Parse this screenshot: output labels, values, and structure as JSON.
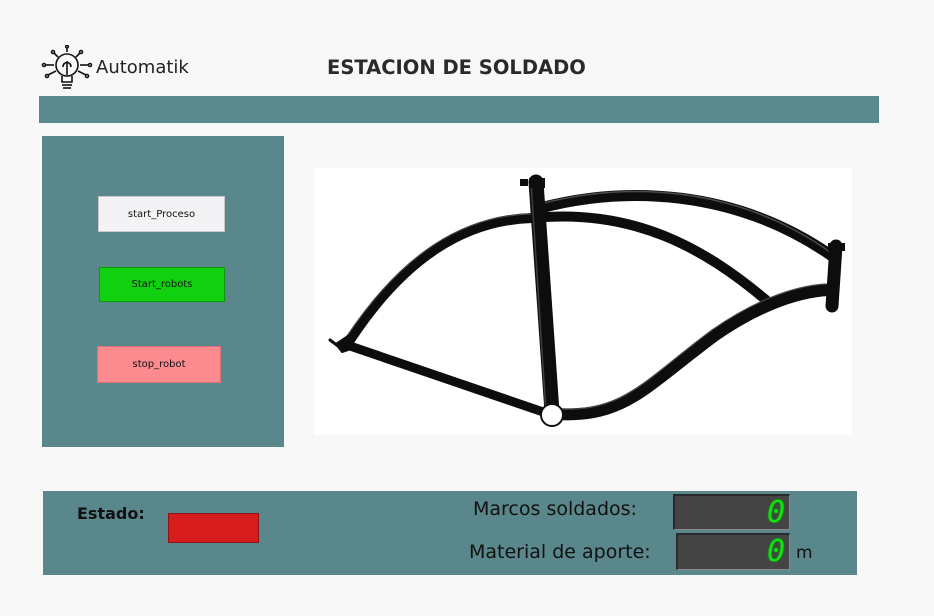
{
  "header": {
    "brand": "Automatik",
    "title": "ESTACION DE SOLDADO",
    "logo_icon": "lightbulb-circuit-icon"
  },
  "controls": {
    "start_proceso": "start_Proceso",
    "start_robots": "Start_robots",
    "stop_robot": "stop_robot"
  },
  "viewport": {
    "image": "bicycle-frame"
  },
  "status": {
    "estado_label": "Estado:",
    "estado_color": "#d61c1c",
    "marcos_label": "Marcos soldados:",
    "marcos_value": "0",
    "material_label": "Material de aporte:",
    "material_value": "0",
    "material_unit": "m"
  },
  "colors": {
    "panel": "#5a878b",
    "start_robots": "#10d010",
    "stop_robot": "#fb8b8f",
    "lcd_digit": "#11e011"
  }
}
